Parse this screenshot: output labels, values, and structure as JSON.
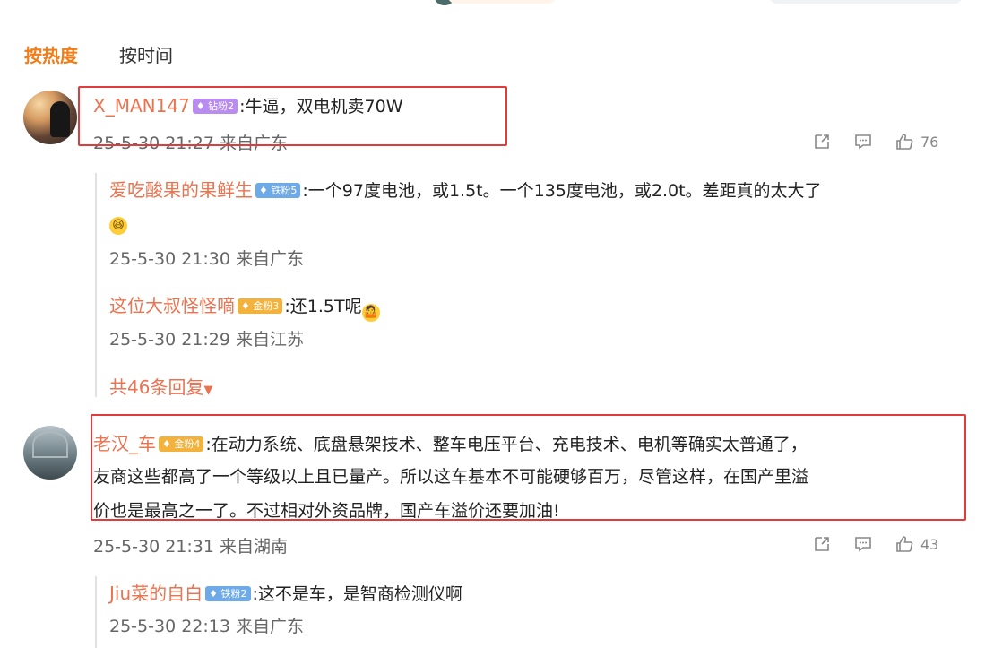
{
  "sort": {
    "hot": "按热度",
    "time": "按时间"
  },
  "comments": [
    {
      "user": "X_MAN147",
      "badge": "钻粉2",
      "text": ":牛逼，双电机卖70W",
      "meta": "25-5-30 21:27 来自广东",
      "likes": "76",
      "replies": [
        {
          "user": "爱吃酸果的果鲜生",
          "badge": "铁粉5",
          "text": ":一个97度电池，或1.5t。一个135度电池，或2.0t。差距真的太大了",
          "meta": "25-5-30 21:30 来自广东"
        },
        {
          "user": "这位大叔怪怪嘀",
          "badge": "金粉3",
          "text": ":还1.5T呢",
          "meta": "25-5-30 21:29 来自江苏"
        }
      ],
      "more_replies": "共46条回复"
    },
    {
      "user": "老汉_车",
      "badge": "金粉4",
      "text_lines": [
        ":在动力系统、底盘悬架技术、整车电压平台、充电技术、电机等确实太普通了，",
        "友商这些都高了一个等级以上且已量产。所以这车基本不可能硬够百万，尽管这样，在国产里溢",
        "价也是最高之一了。不过相对外资品牌，国产车溢价还要加油!"
      ],
      "meta": "25-5-30 21:31 来自湖南",
      "likes": "43",
      "replies": [
        {
          "user": "Jiu菜的自白",
          "badge": "铁粉2",
          "text": ":这不是车，是智商检测仪啊",
          "meta": "25-5-30 22:13 来自广东"
        }
      ]
    }
  ],
  "colors": {
    "accent": "#f07d17",
    "username": "#eb7350",
    "highlight": "#e23b3b"
  },
  "icons": [
    "share-icon",
    "comment-icon",
    "like-icon",
    "laugh-emoji",
    "shrug-emoji",
    "chevron-down-icon"
  ]
}
